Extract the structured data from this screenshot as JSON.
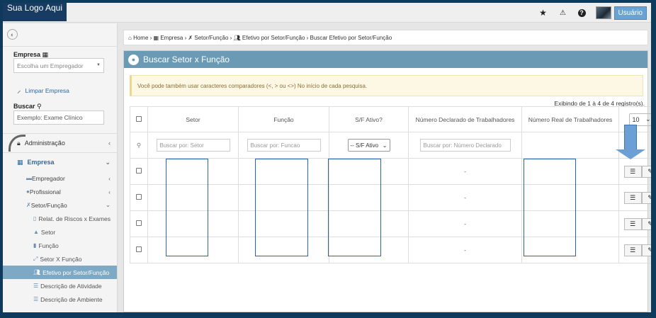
{
  "app": {
    "logo_text": "Sua Logo Aqui",
    "user_label": "Usuário"
  },
  "topbar": {
    "icons": [
      "star-icon",
      "warning-icon",
      "help-icon"
    ]
  },
  "sidebar": {
    "empresa_label": "Empresa",
    "empresa_placeholder": "Escolha um Empregador",
    "limpar_label": "Limpar Empresa",
    "buscar_label": "Buscar",
    "buscar_value": "Exemplo: Exame Clínico",
    "menu": {
      "administracao": "Administração",
      "empresa": "Empresa",
      "empregador": "Empregador",
      "profissional": "Profissional",
      "setor_funcao": "Setor/Função",
      "sub": [
        {
          "label": "Relat. de Riscos x Exames",
          "icon": "report-icon"
        },
        {
          "label": "Setor",
          "icon": "sitemap-icon"
        },
        {
          "label": "Função",
          "icon": "chart-icon"
        },
        {
          "label": "Setor X Função",
          "icon": "link-icon"
        },
        {
          "label": "Efetivo por Setor/Função",
          "icon": "users-icon"
        },
        {
          "label": "Descrição de Atividade",
          "icon": "list-icon"
        },
        {
          "label": "Descrição de Ambiente",
          "icon": "list-icon"
        }
      ]
    }
  },
  "breadcrumb": {
    "home": "Home",
    "empresa": "Empresa",
    "setor_funcao": "Setor/Função",
    "efetivo": "Efetivo por Setor/Função",
    "current": "Buscar Efetivo por Setor/Função"
  },
  "panel": {
    "title": "Buscar Setor x Função",
    "alert": "Você pode também usar caracteres comparadores (<, > ou <>) No início de cada pesquisa.",
    "info": "Exibindo de 1 à 4 de 4 registro(s).",
    "page_length": "10"
  },
  "table": {
    "headers": {
      "setor": "Setor",
      "funcao": "Função",
      "ativo": "S/F Ativo?",
      "declarado": "Número Declarado de Trabalhadores",
      "real": "Número Real de Trabalhadores"
    },
    "filters": {
      "setor": "Buscar por: Setor",
      "funcao": "Buscar por: Funcao",
      "ativo": "-- S/F Ativo",
      "declarado": "Buscar por: Número Declarado"
    },
    "rows": [
      {
        "declarado": "-"
      },
      {
        "declarado": "-"
      },
      {
        "declarado": "-"
      },
      {
        "declarado": "-"
      }
    ]
  },
  "colors": {
    "brand": "#183b61",
    "panel_header": "#6b9ab4",
    "selected_menu": "#7ea9c4",
    "link": "#2b6aa3",
    "arrow": "#6c9fd6"
  }
}
